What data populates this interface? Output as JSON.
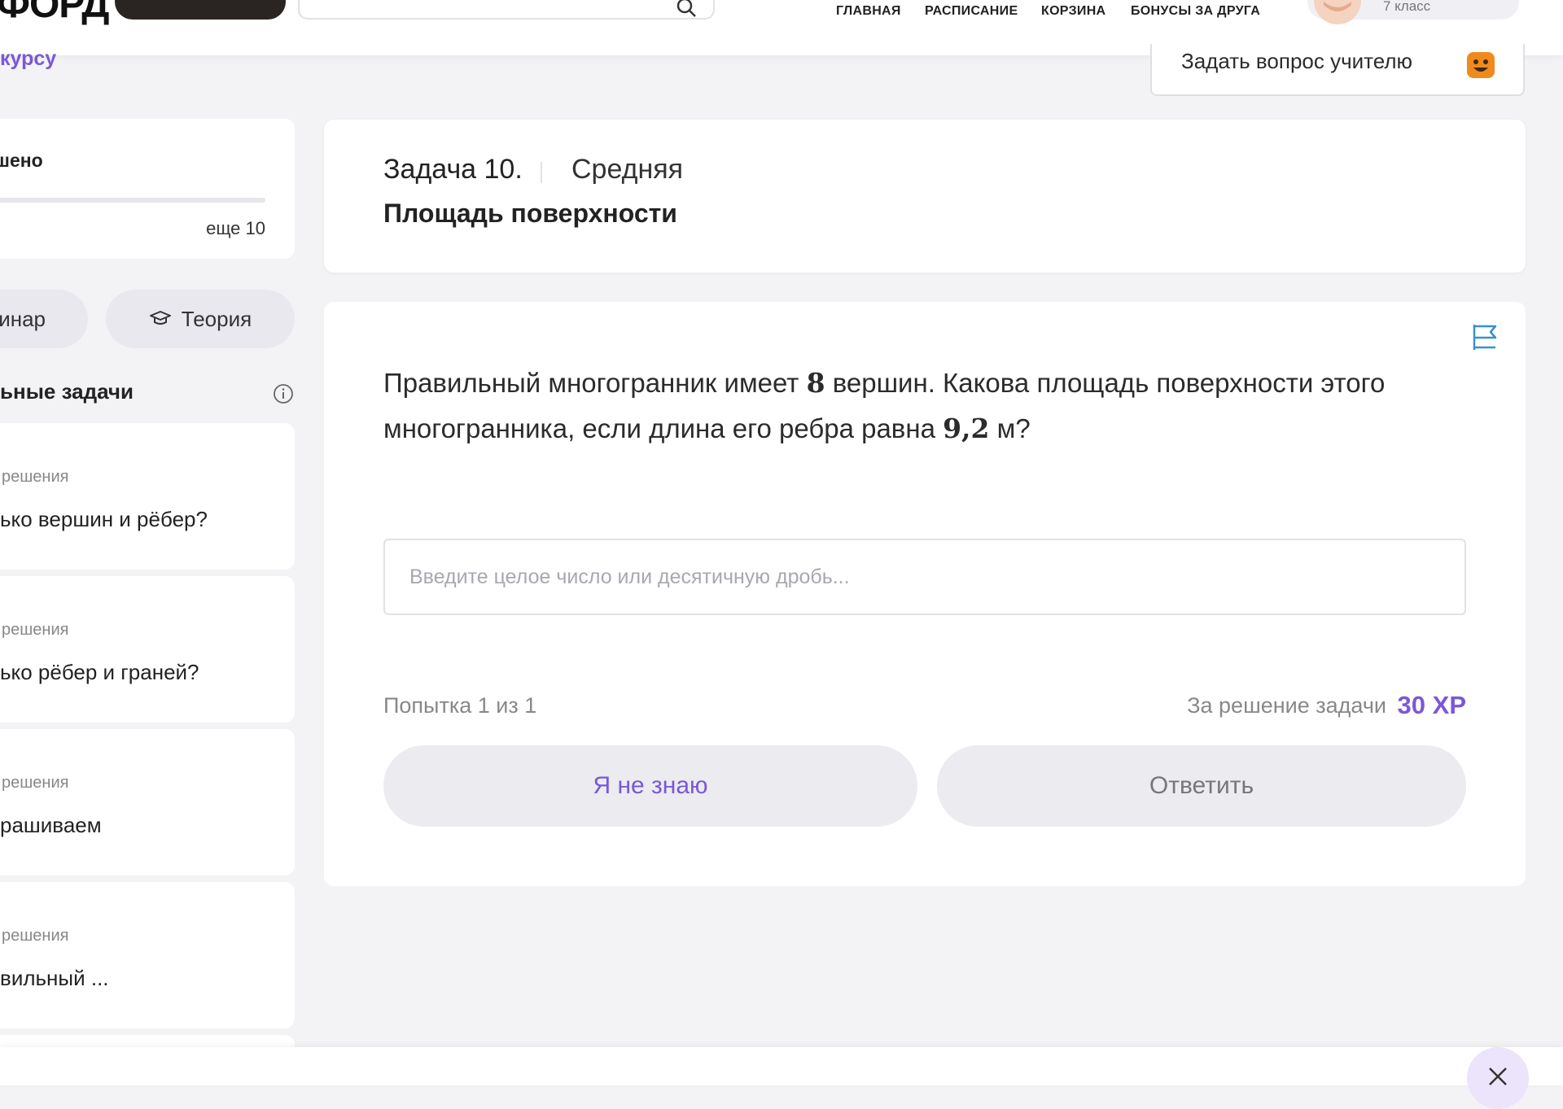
{
  "header": {
    "logo_text": "ФОРД",
    "nav": [
      "ГЛАВНАЯ",
      "РАСПИСАНИЕ",
      "КОРЗИНА",
      "БОНУСЫ ЗА ДРУГА"
    ],
    "profile": {
      "class_label": "7 класс"
    }
  },
  "back_link": "курсу",
  "ask_teacher": {
    "label": "Задать вопрос учителю",
    "icon": "smile-emoji-icon"
  },
  "sidebar": {
    "progress": {
      "solved_label": "ешено",
      "remaining_label": "еще 10"
    },
    "buttons": {
      "webinar": "инар",
      "theory": "Теория"
    },
    "section_title": "ьные задачи",
    "tasks": [
      {
        "meta": "решения",
        "name": "ько вершин и рёбер?"
      },
      {
        "meta": "решения",
        "name": "ько рёбер и граней?"
      },
      {
        "meta": "решения",
        "name": "рашиваем"
      },
      {
        "meta": "решения",
        "name": "вильный ..."
      }
    ]
  },
  "task": {
    "number": "Задача 10.",
    "difficulty": "Средняя",
    "title": "Площадь поверхности",
    "question_part1": "Правильный многогранник имеет ",
    "question_num1": "8",
    "question_part2": " вершин. Какова площадь поверхности этого многогранника, если длина его ребра равна ",
    "question_num2": "9,2",
    "question_part3": " м?",
    "input_placeholder": "Введите целое число или десятичную дробь...",
    "attempt": "Попытка 1 из 1",
    "reward_label": "За решение задачи",
    "reward_value": "30 XP",
    "dont_know_label": "Я не знаю",
    "answer_label": "Ответить"
  },
  "colors": {
    "accent": "#7b58d6",
    "background": "#f3f3f6",
    "button_bg": "#ebebf0"
  }
}
